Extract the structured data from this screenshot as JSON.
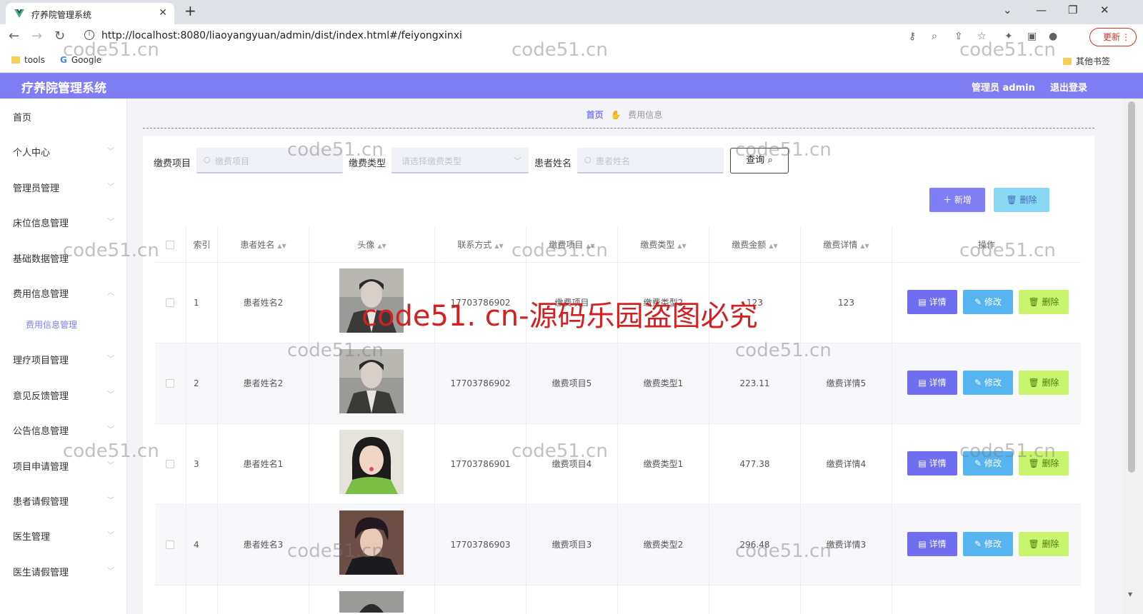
{
  "browser": {
    "tab_title": "疗养院管理系统",
    "url": "http://localhost:8080/liaoyangyuan/admin/dist/index.html#/feiyongxinxi",
    "update_label": "更新",
    "bookmarks": [
      "tools",
      "Google"
    ],
    "other_bookmarks": "其他书签"
  },
  "header": {
    "title": "疗养院管理系统",
    "user_label": "管理员 admin",
    "logout_label": "退出登录",
    "accent_color": "#7f7ef5"
  },
  "sidebar": {
    "items": [
      {
        "label": "首页"
      },
      {
        "label": "个人中心"
      },
      {
        "label": "管理员管理"
      },
      {
        "label": "床位信息管理"
      },
      {
        "label": "基础数据管理"
      },
      {
        "label": "费用信息管理"
      },
      {
        "label": "费用信息管理"
      },
      {
        "label": "理疗项目管理"
      },
      {
        "label": "意见反馈管理"
      },
      {
        "label": "公告信息管理"
      },
      {
        "label": "项目申请管理"
      },
      {
        "label": "患者请假管理"
      },
      {
        "label": "医生管理"
      },
      {
        "label": "医生请假管理"
      }
    ]
  },
  "breadcrumb": {
    "home": "首页",
    "current": "费用信息"
  },
  "search": {
    "item_label": "缴费项目",
    "item_placeholder": "缴费项目",
    "type_label": "缴费类型",
    "type_placeholder": "请选择缴费类型",
    "name_label": "患者姓名",
    "name_placeholder": "患者姓名",
    "query_label": "查询"
  },
  "toolbar": {
    "add_label": "新增",
    "delete_label": "删除"
  },
  "table": {
    "columns": [
      "索引",
      "患者姓名",
      "头像",
      "联系方式",
      "缴费项目",
      "缴费类型",
      "缴费金额",
      "缴费详情",
      "操作"
    ],
    "rows": [
      {
        "index": "1",
        "name": "患者姓名2",
        "phone": "17703786902",
        "item": "缴费项目",
        "type": "缴费类型2",
        "amount": "123",
        "detail": "123"
      },
      {
        "index": "2",
        "name": "患者姓名2",
        "phone": "17703786902",
        "item": "缴费项目5",
        "type": "缴费类型1",
        "amount": "223.11",
        "detail": "缴费详情5"
      },
      {
        "index": "3",
        "name": "患者姓名1",
        "phone": "17703786901",
        "item": "缴费项目4",
        "type": "缴费类型1",
        "amount": "477.38",
        "detail": "缴费详情4"
      },
      {
        "index": "4",
        "name": "患者姓名3",
        "phone": "17703786903",
        "item": "缴费项目3",
        "type": "缴费类型2",
        "amount": "296.48",
        "detail": "缴费详情3"
      }
    ],
    "actions": {
      "detail": "详情",
      "edit": "修改",
      "delete": "删除"
    }
  },
  "watermark": {
    "small": "code51.cn",
    "big": "code51. cn-源码乐园盗图必究"
  }
}
